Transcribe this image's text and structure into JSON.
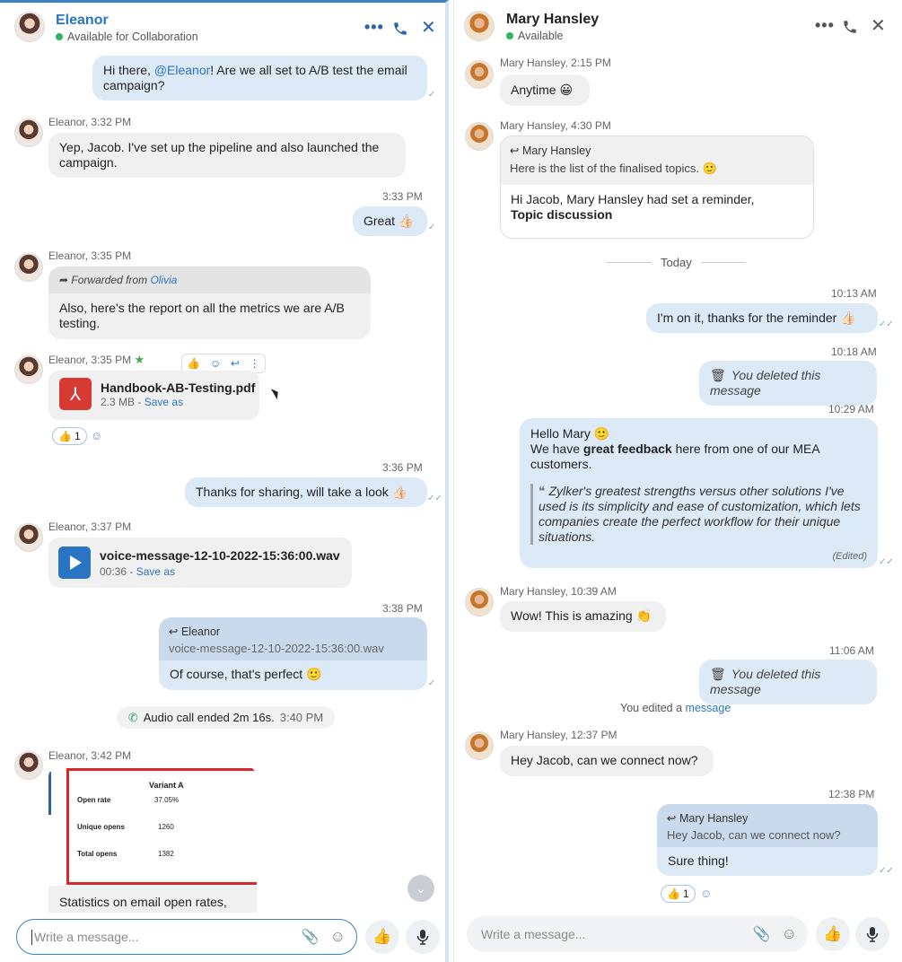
{
  "left": {
    "header": {
      "name": "Eleanor",
      "status": "Available for Collaboration"
    },
    "m1": {
      "pre": "Hi there, ",
      "mention": "@Eleanor",
      "post": "! Are we all set to A/B test the email campaign?"
    },
    "m2": {
      "sender": "Eleanor,",
      "time": "3:32 PM",
      "text": "Yep, Jacob. I've set up the pipeline and also launched the campaign."
    },
    "m3": {
      "time": "3:33 PM",
      "text": "Great 👍🏻"
    },
    "m4": {
      "sender": "Eleanor,",
      "time": "3:35 PM",
      "fwd_label": "Forwarded from",
      "fwd_name": "Olivia",
      "text": "Also, here's the report on all the metrics we are A/B testing."
    },
    "m5": {
      "sender": "Eleanor,",
      "time": "3:35 PM",
      "file_name": "Handbook-AB-Testing.pdf",
      "file_size": "2.3 MB -",
      "save_as": "Save as",
      "reaction": "👍",
      "reaction_count": "1"
    },
    "m6": {
      "time": "3:36 PM",
      "text": "Thanks for sharing, will take a look 👍🏻"
    },
    "m7": {
      "sender": "Eleanor,",
      "time": "3:37 PM",
      "file_name": "voice-message-12-10-2022-15:36:00.wav",
      "duration": "00:36 -",
      "save_as": "Save as"
    },
    "m8": {
      "time": "3:38 PM",
      "reply_name": "Eleanor",
      "reply_text": "voice-message-12-10-2022-15:36:00.wav",
      "text": "Of course, that's perfect 🙂"
    },
    "call": {
      "text": "Audio call ended 2m 16s.",
      "time": "3:40 PM"
    },
    "m9": {
      "sender": "Eleanor,",
      "time": "3:42 PM",
      "img_title": "Variant A",
      "rows": [
        {
          "label": "Open rate",
          "value": "37.05%"
        },
        {
          "label": "Unique opens",
          "value": "1260"
        },
        {
          "label": "Total opens",
          "value": "1382"
        }
      ],
      "caption": "Statistics on email open rates,"
    },
    "composer": {
      "placeholder": "Write a message..."
    }
  },
  "right": {
    "header": {
      "name": "Mary Hansley",
      "status": "Available"
    },
    "r1": {
      "sender": "Mary Hansley,",
      "time": "2:15 PM",
      "text": "Anytime 😀"
    },
    "r2": {
      "sender": "Mary Hansley,",
      "time": "4:30 PM",
      "quote_name": "Mary Hansley",
      "quote_text": "Here is the list of the finalised topics. 🙂",
      "text": "Hi Jacob, Mary Hansley had set a reminder,",
      "bold": "Topic discussion"
    },
    "divider": "Today",
    "r3": {
      "time": "10:13 AM",
      "text": "I'm on it, thanks for the reminder 👍🏻"
    },
    "r4": {
      "time": "10:18 AM",
      "text": "You deleted this message"
    },
    "r5": {
      "time": "10:29 AM",
      "line1": "Hello Mary 🙂",
      "line2_pre": "We have ",
      "line2_bold": "great feedback",
      "line2_post": " here from one of our MEA customers.",
      "quote": "Zylker's greatest strengths versus other solutions I've used is its simplicity and ease of customization, which lets companies create the perfect workflow for their unique situations.",
      "edited": "(Edited)"
    },
    "r6": {
      "sender": "Mary Hansley,",
      "time": "10:39 AM",
      "text": "Wow! This is amazing 👏"
    },
    "r7": {
      "time": "11:06 AM",
      "text": "You deleted this message"
    },
    "edited_note": {
      "pre": "You edited a",
      "link": "message"
    },
    "r8": {
      "sender": "Mary Hansley,",
      "time": "12:37 PM",
      "text": "Hey Jacob, can we connect now?"
    },
    "r9": {
      "time": "12:38 PM",
      "reply_name": "Mary Hansley",
      "reply_text": "Hey Jacob, can we connect now?",
      "text": "Sure thing!",
      "reaction": "👍",
      "reaction_count": "1"
    },
    "composer": {
      "placeholder": "Write a message..."
    }
  },
  "icons": {
    "like": "👍",
    "mic": "🎤",
    "attach": "📎",
    "emoji": "☺"
  }
}
